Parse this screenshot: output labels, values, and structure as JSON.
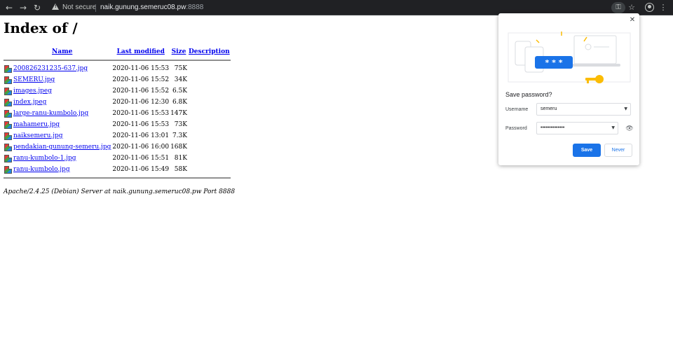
{
  "browser": {
    "back_icon": "arrow-left-icon",
    "forward_icon": "arrow-right-icon",
    "reload_icon": "reload-icon",
    "security_text": "Not secure",
    "url_host": "naik.gunung.semeruc08.pw",
    "url_port": ":8888",
    "key_glyph": "⚿",
    "star_glyph": "☆",
    "menu_glyph": "⋮"
  },
  "page": {
    "title": "Index of /",
    "columns": {
      "name": "Name",
      "last_modified": "Last modified",
      "size": "Size",
      "description": "Description"
    },
    "files": [
      {
        "name": "200826231235-637.jpg",
        "modified": "2020-11-06 15:53",
        "size": "75K"
      },
      {
        "name": "SEMERU.jpg",
        "modified": "2020-11-06 15:52",
        "size": "34K"
      },
      {
        "name": "images.jpeg",
        "modified": "2020-11-06 15:52",
        "size": "6.5K"
      },
      {
        "name": "index.jpeg",
        "modified": "2020-11-06 12:30",
        "size": "6.8K"
      },
      {
        "name": "large-ranu-kumbolo.jpg",
        "modified": "2020-11-06 15:53",
        "size": "147K"
      },
      {
        "name": "mahameru.jpg",
        "modified": "2020-11-06 15:53",
        "size": "73K"
      },
      {
        "name": "naiksemeru.jpg",
        "modified": "2020-11-06 13:01",
        "size": "7.3K"
      },
      {
        "name": "pendakian-gunung-semeru.jpg",
        "modified": "2020-11-06 16:00",
        "size": "168K"
      },
      {
        "name": "ranu-kumbolo-1.jpg",
        "modified": "2020-11-06 15:51",
        "size": "81K"
      },
      {
        "name": "ranu-kumbolo.jpg",
        "modified": "2020-11-06 15:49",
        "size": "58K"
      }
    ],
    "footer": "Apache/2.4.25 (Debian) Server at naik.gunung.semeruc08.pw Port 8888"
  },
  "password_bubble": {
    "title": "Save password?",
    "username_label": "Username",
    "username_value": "semeru",
    "password_label": "Password",
    "password_value": "••••••••••••••",
    "illustration_text": "* * *",
    "save_label": "Save",
    "never_label": "Never",
    "accent_color": "#1a73e8"
  }
}
